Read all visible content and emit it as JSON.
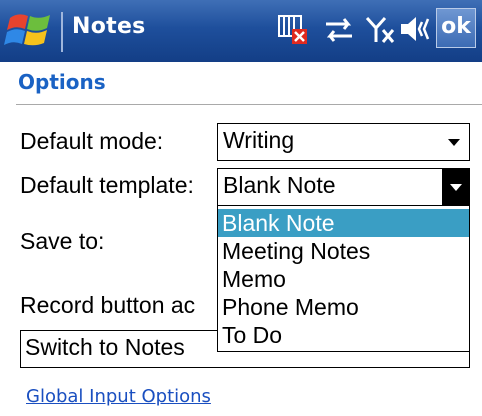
{
  "titlebar": {
    "app_title": "Notes",
    "ok_label": "ok",
    "status_icons": [
      "memory-warning-icon",
      "connectivity-icon",
      "signal-off-icon",
      "speaker-icon"
    ]
  },
  "page": {
    "title": "Options"
  },
  "form": {
    "default_mode": {
      "label": "Default mode:",
      "value": "Writing"
    },
    "default_template": {
      "label": "Default template:",
      "value": "Blank Note",
      "options": [
        "Blank Note",
        "Meeting Notes",
        "Memo",
        "Phone Memo",
        "To Do"
      ]
    },
    "save_to": {
      "label": "Save to:"
    },
    "record_button": {
      "label": "Record button ac",
      "value": "Switch to Notes"
    }
  },
  "links": {
    "global_input": "Global Input Options"
  },
  "colors": {
    "titlebar": "#1e4f9c",
    "heading": "#1a62c4",
    "selection": "#3a9ec4",
    "link": "#1a4fc0"
  }
}
